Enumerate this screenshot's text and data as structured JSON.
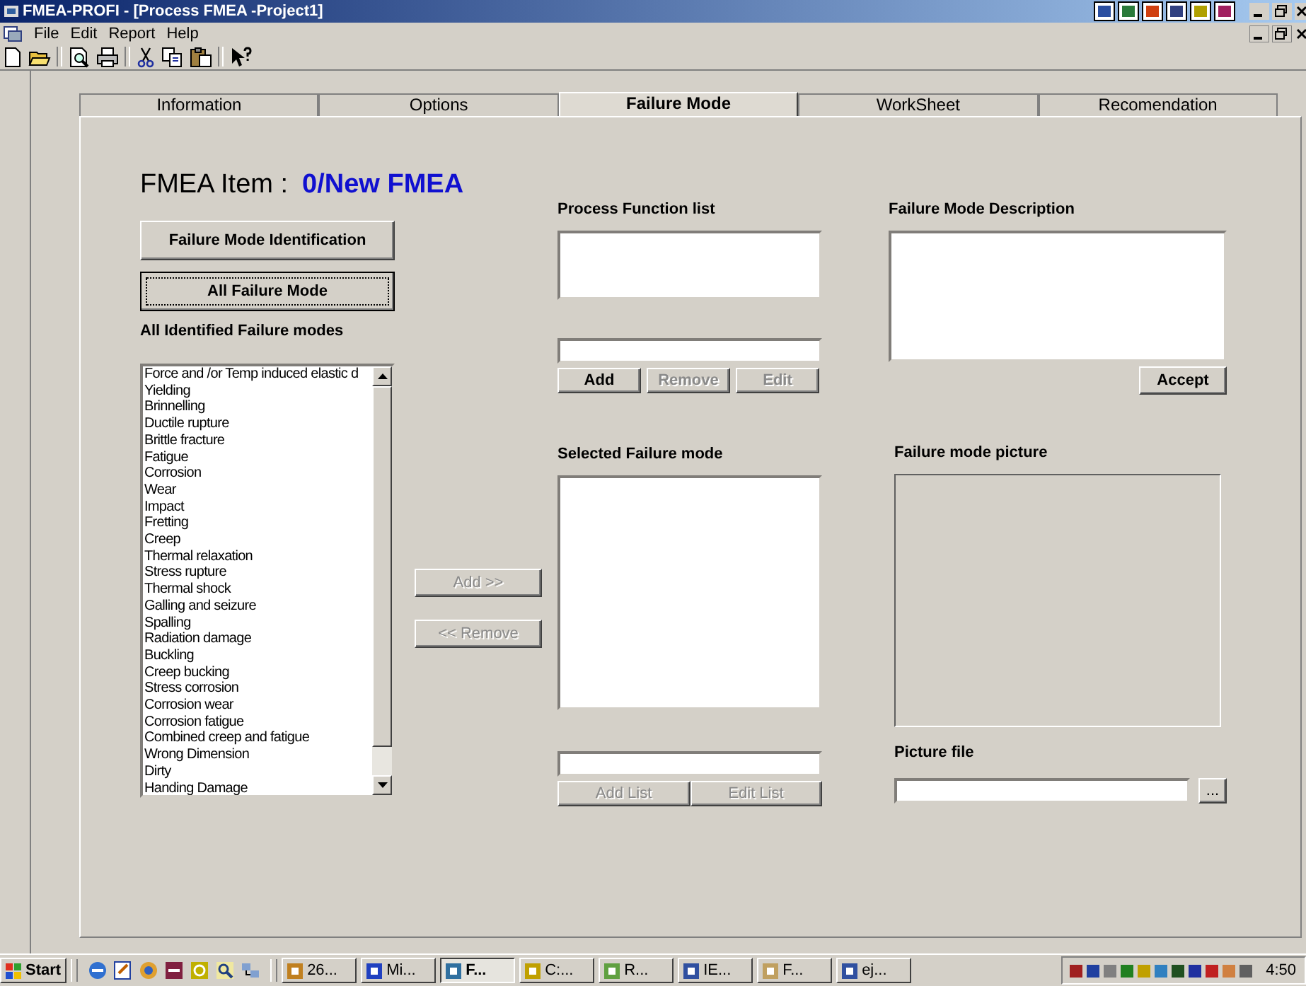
{
  "window": {
    "title": "FMEA-PROFI - [Process FMEA -Project1]"
  },
  "menu": [
    "File",
    "Edit",
    "Report",
    "Help"
  ],
  "tabs": [
    {
      "label": "Information",
      "selected": false
    },
    {
      "label": "Options",
      "selected": false
    },
    {
      "label": "Failure Mode",
      "selected": true
    },
    {
      "label": "WorkSheet",
      "selected": false
    },
    {
      "label": "Recomendation",
      "selected": false
    }
  ],
  "item": {
    "label": "FMEA Item :",
    "value": "0/New FMEA"
  },
  "left": {
    "buttons": [
      {
        "label": "Failure Mode Identification",
        "focused": false
      },
      {
        "label": "All Failure Mode",
        "focused": true
      }
    ],
    "list_label": "All Identified Failure modes",
    "items": [
      "Force and /or Temp induced elastic d",
      "Yielding",
      "Brinnelling",
      "Ductile rupture",
      "Brittle fracture",
      "Fatigue",
      "Corrosion",
      "Wear",
      "Impact",
      "Fretting",
      "Creep",
      "Thermal relaxation",
      "Stress rupture",
      "Thermal shock",
      "Galling and seizure",
      "Spalling",
      "Radiation damage",
      "Buckling",
      "Creep bucking",
      "Stress corrosion",
      "Corrosion wear",
      "Corrosion fatigue",
      "Combined creep and fatigue",
      "Wrong Dimension",
      "Dirty",
      "Handing Damage"
    ]
  },
  "transfer": [
    {
      "label": "Add   >>",
      "disabled": true
    },
    {
      "label": "<< Remove",
      "disabled": true
    }
  ],
  "process": {
    "label": "Process Function list",
    "buttons": [
      {
        "label": "Add",
        "disabled": false
      },
      {
        "label": "Remove",
        "disabled": true
      },
      {
        "label": "Edit",
        "disabled": true
      }
    ]
  },
  "selected": {
    "label": "Selected Failure mode",
    "buttons": [
      {
        "label": "Add List",
        "disabled": true
      },
      {
        "label": "Edit List",
        "disabled": true
      }
    ]
  },
  "description": {
    "label": "Failure Mode Description",
    "button": {
      "label": "Accept",
      "disabled": false
    }
  },
  "picture": {
    "label": "Failure mode picture",
    "file_label": "Picture file",
    "browse": "..."
  },
  "taskbar": {
    "start": "Start",
    "tasks": [
      {
        "label": "26...",
        "selected": false
      },
      {
        "label": "Mi...",
        "selected": false
      },
      {
        "label": "F...",
        "selected": true
      },
      {
        "label": "C:...",
        "selected": false
      },
      {
        "label": "R...",
        "selected": false
      },
      {
        "label": "IE...",
        "selected": false
      },
      {
        "label": "F...",
        "selected": false
      },
      {
        "label": "ej...",
        "selected": false
      }
    ],
    "clock": "4:50"
  }
}
